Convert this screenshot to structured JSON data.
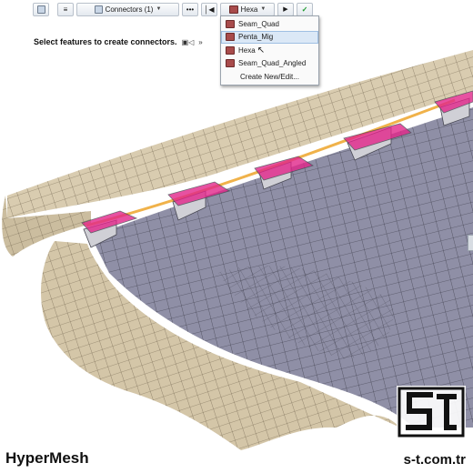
{
  "toolbar": {
    "list_icon": "list-icon",
    "connectors_label": "Connectors (1)",
    "more_label": "•••",
    "rewind_icon": "rewind-icon",
    "config_label": "Hexa",
    "play_icon": "play-icon",
    "confirm_icon": "check-icon"
  },
  "prompt": {
    "text": "Select features to create connectors.",
    "hint_glyph": "»"
  },
  "config_menu": {
    "items": [
      {
        "label": "Seam_Quad"
      },
      {
        "label": "Penta_Mig"
      },
      {
        "label": "Hexa"
      },
      {
        "label": "Seam_Quad_Angled"
      },
      {
        "label": "Create New/Edit..."
      }
    ],
    "highlighted": "Penta_Mig"
  },
  "branding": {
    "app_name": "HyperMesh",
    "logo_letters": "St",
    "site": "s-t.com.tr"
  },
  "colors": {
    "mesh_tan": "#d6c8aa",
    "mesh_gray": "#8e8ea3",
    "weld_magenta": "#e2268a",
    "seam_orange": "#f0b24a"
  }
}
